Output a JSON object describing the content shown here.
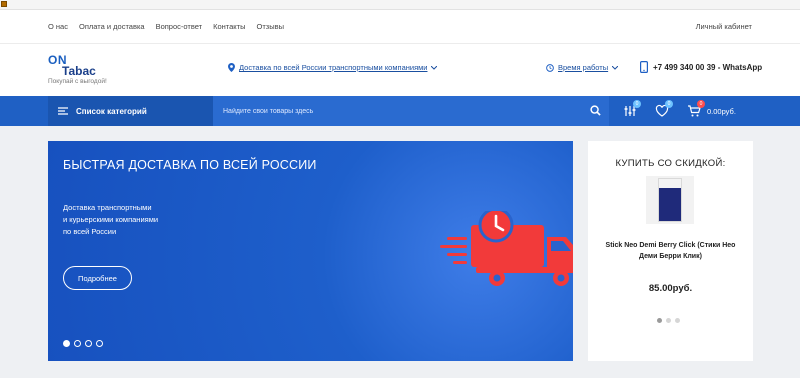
{
  "top_nav": {
    "links": [
      "О нас",
      "Оплата и доставка",
      "Вопрос-ответ",
      "Контакты",
      "Отзывы"
    ],
    "account": "Личный кабинет"
  },
  "header": {
    "logo_on": "ON",
    "logo_tabac": "Tabac",
    "logo_tagline": "Покупай с выгодой!",
    "delivery_text": "Доставка по всей России транспортными компаниями",
    "hours_text": "Время работы",
    "phone_text": "+7 499 340 00 39 - WhatsApp"
  },
  "navbar": {
    "catalog_label": "Список категорий",
    "search_placeholder": "Найдите свои товары здесь",
    "compare_count": "0",
    "wishlist_count": "0",
    "cart_count": "0",
    "cart_total": "0.00руб."
  },
  "banner": {
    "title": "БЫСТРАЯ ДОСТАВКА ПО ВСЕЙ РОССИИ",
    "desc_lines": [
      "Доставка транспортными",
      "и курьерскими компаниями",
      "по всей России"
    ],
    "button": "Подробнее",
    "active_slide": 0
  },
  "sale": {
    "title": "КУПИТЬ СО СКИДКОЙ:",
    "product_name": "Stick Neo Demi Berry Click (Стики Нео Деми Берри Клик)",
    "price": "85.00руб."
  },
  "colors": {
    "primary": "#1f60c4",
    "truck": "#f23a3a"
  }
}
